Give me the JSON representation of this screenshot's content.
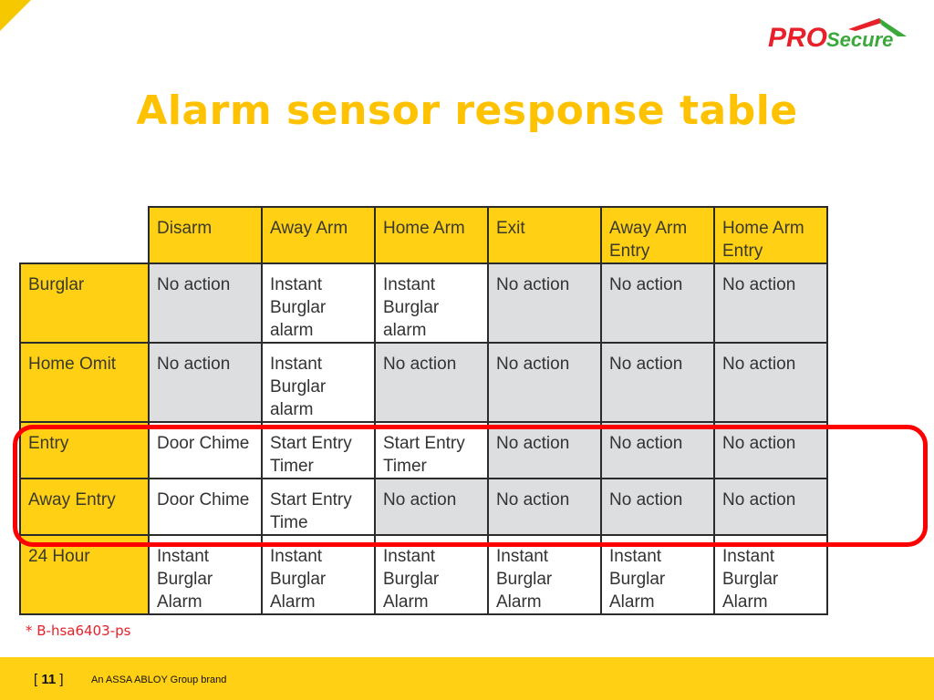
{
  "logo": {
    "text_pro": "PRO",
    "text_secure": "Secure",
    "colors": {
      "pro": "#e8202a",
      "secure": "#3aa83a",
      "roof_red": "#e8202a",
      "roof_green": "#3aa83a"
    }
  },
  "title": "Alarm sensor response table",
  "table": {
    "columns": [
      "Disarm",
      "Away Arm",
      "Home Arm",
      "Exit",
      "Away Arm Entry",
      "Home Arm Entry"
    ],
    "rows": [
      {
        "sensor": "Burglar",
        "cells": [
          {
            "text": "No action",
            "shade": "grey"
          },
          {
            "text": "Instant Burglar alarm",
            "shade": "white"
          },
          {
            "text": "Instant Burglar alarm",
            "shade": "white"
          },
          {
            "text": "No action",
            "shade": "grey"
          },
          {
            "text": "No action",
            "shade": "grey"
          },
          {
            "text": "No action",
            "shade": "grey"
          }
        ]
      },
      {
        "sensor": "Home Omit",
        "cells": [
          {
            "text": "No action",
            "shade": "grey"
          },
          {
            "text": "Instant Burglar alarm",
            "shade": "white"
          },
          {
            "text": "No action",
            "shade": "grey"
          },
          {
            "text": "No action",
            "shade": "grey"
          },
          {
            "text": "No action",
            "shade": "grey"
          },
          {
            "text": "No action",
            "shade": "grey"
          }
        ]
      },
      {
        "sensor": "Entry",
        "cells": [
          {
            "text": "Door Chime",
            "shade": "white"
          },
          {
            "text": "Start Entry Timer",
            "shade": "white"
          },
          {
            "text": "Start Entry Timer",
            "shade": "white"
          },
          {
            "text": "No action",
            "shade": "grey"
          },
          {
            "text": "No action",
            "shade": "grey"
          },
          {
            "text": "No action",
            "shade": "grey"
          }
        ]
      },
      {
        "sensor": "Away Entry",
        "highlighted": true,
        "cells": [
          {
            "text": "Door Chime",
            "shade": "white"
          },
          {
            "text": "Start Entry Time",
            "shade": "white"
          },
          {
            "text": "No action",
            "shade": "grey"
          },
          {
            "text": "No action",
            "shade": "grey"
          },
          {
            "text": "No action",
            "shade": "grey"
          },
          {
            "text": "No action",
            "shade": "grey"
          }
        ]
      },
      {
        "sensor": "24 Hour",
        "highlighted": true,
        "cells": [
          {
            "text": "Instant Burglar Alarm",
            "shade": "white"
          },
          {
            "text": "Instant Burglar Alarm",
            "shade": "white"
          },
          {
            "text": "Instant Burglar Alarm",
            "shade": "white"
          },
          {
            "text": "Instant Burglar Alarm",
            "shade": "white"
          },
          {
            "text": "Instant Burglar Alarm",
            "shade": "white"
          },
          {
            "text": "Instant Burglar Alarm",
            "shade": "white"
          }
        ]
      }
    ],
    "colors": {
      "header": "#ffd014",
      "grey": "#dcdee0",
      "white": "#ffffff",
      "highlight": "#ff0000"
    }
  },
  "footnote": "* B-hsa6403-ps",
  "footer": {
    "page_open": "[ ",
    "page_number": "11",
    "page_close": " ]",
    "brand": "An ASSA ABLOY Group brand"
  },
  "accent_color": "#ffc200"
}
